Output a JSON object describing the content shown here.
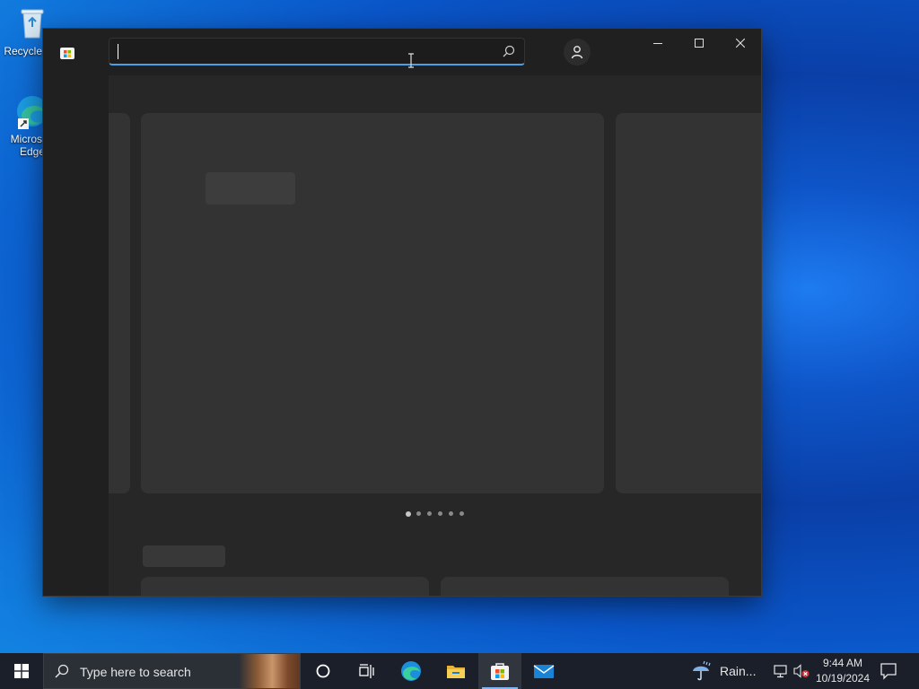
{
  "desktop": {
    "icons": [
      {
        "label": "Recycle Bin"
      },
      {
        "label": "Microsoft Edge"
      }
    ]
  },
  "store_window": {
    "search": {
      "value": "",
      "placeholder": ""
    },
    "hero_dots": {
      "count": 6,
      "active_index": 0
    }
  },
  "taskbar": {
    "search_placeholder": "Type here to search",
    "pinned": [
      "cortana-icon",
      "task-view-icon",
      "edge-icon",
      "file-explorer-icon",
      "store-icon",
      "mail-icon"
    ],
    "active_app": "store-icon",
    "weather_text": "Rain...",
    "time": "9:44 AM",
    "date": "10/19/2024"
  },
  "colors": {
    "accent": "#4aa0e6",
    "window_bg": "#202020",
    "content_bg": "#272727",
    "placeholder_panel": "#333333",
    "taskbar_bg": "#1a1f2a"
  }
}
